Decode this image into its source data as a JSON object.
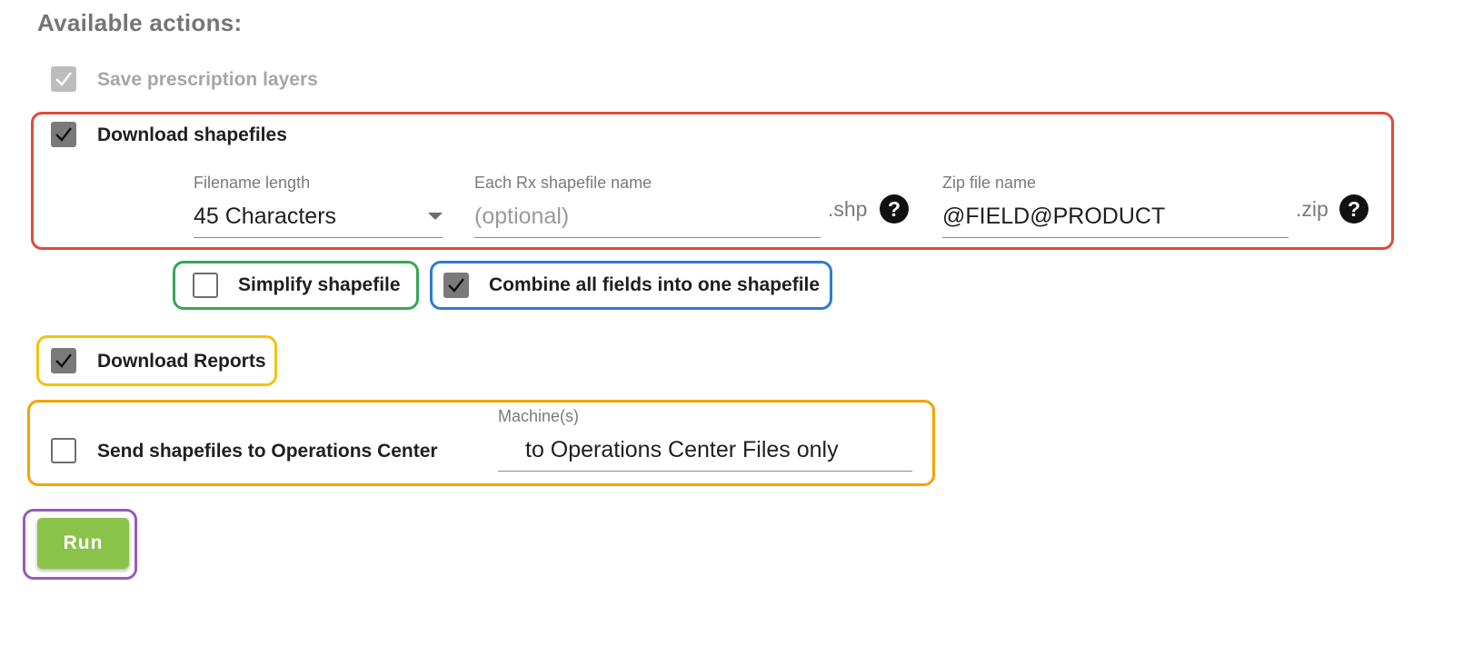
{
  "heading": "Available actions:",
  "save_layers": {
    "label": "Save prescription layers",
    "checked": true,
    "disabled": true
  },
  "download_shapefiles": {
    "label": "Download shapefiles",
    "checked": true,
    "filename_length": {
      "label": "Filename length",
      "value": "45 Characters"
    },
    "rx_name": {
      "label": "Each Rx shapefile name",
      "placeholder": "(optional)",
      "value": "",
      "suffix": ".shp"
    },
    "zip_name": {
      "label": "Zip file name",
      "value": "@FIELD@PRODUCT",
      "suffix": ".zip"
    },
    "help_glyph": "?"
  },
  "simplify": {
    "label": "Simplify shapefile",
    "checked": false
  },
  "combine": {
    "label": "Combine all fields into one shapefile",
    "checked": true
  },
  "download_reports": {
    "label": "Download Reports",
    "checked": true
  },
  "send_ops": {
    "label": "Send shapefiles to Operations Center",
    "checked": false,
    "machines": {
      "label": "Machine(s)",
      "value": "to Operations Center Files only"
    }
  },
  "run_button": "Run",
  "highlight_colors": {
    "download_shapefiles": "#e04a3c",
    "simplify": "#34a853",
    "combine": "#2b7ccf",
    "download_reports": "#f4c20d",
    "send_ops": "#f5a300",
    "run": "#9b59b6"
  },
  "accent_colors": {
    "run_button": "#8bc34a",
    "checkbox_checked": "#7a7a7a"
  }
}
